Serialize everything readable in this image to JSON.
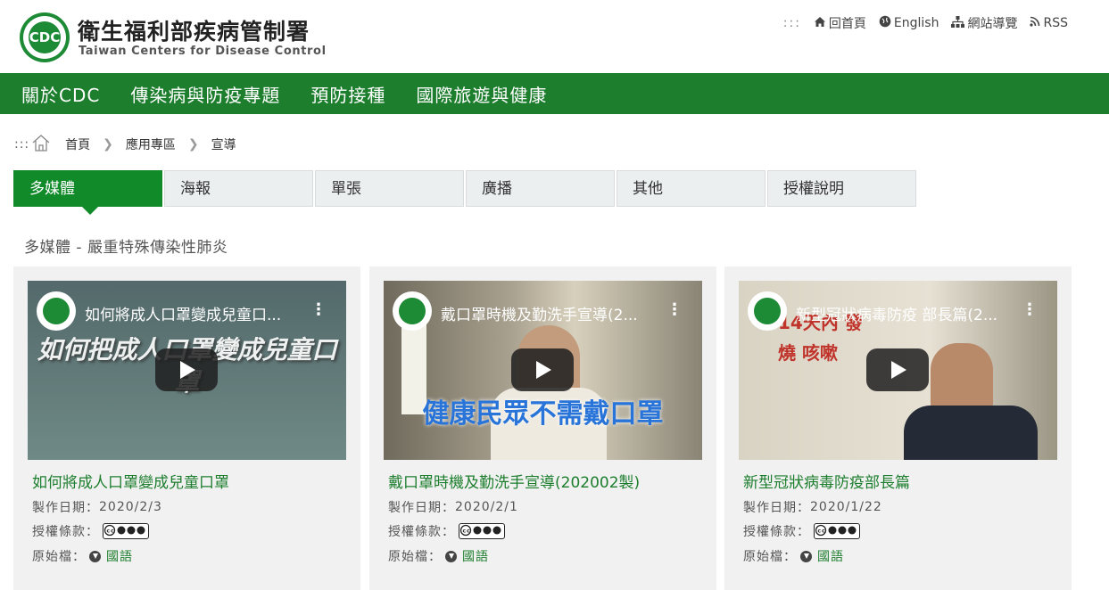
{
  "header": {
    "title": "衛生福利部疾病管制署",
    "subtitle": "Taiwan Centers for Disease Control",
    "logo_text": "CDC",
    "links": [
      {
        "label": "回首頁",
        "icon": "home-icon"
      },
      {
        "label": "English",
        "icon": "globe-icon"
      },
      {
        "label": "網站導覽",
        "icon": "sitemap-icon"
      },
      {
        "label": "RSS",
        "icon": "rss-icon"
      }
    ],
    "dots": ":::"
  },
  "nav": [
    "關於CDC",
    "傳染病與防疫專題",
    "預防接種",
    "國際旅遊與健康"
  ],
  "breadcrumb": {
    "dots": ":::",
    "items": [
      "首頁",
      "應用專區",
      "宣導"
    ]
  },
  "tabs": [
    "多媒體",
    "海報",
    "單張",
    "廣播",
    "其他",
    "授權說明"
  ],
  "section_title": "多媒體 - 嚴重特殊傳染性肺炎",
  "cards": [
    {
      "video_title": "如何將成人口罩變成兒童口...",
      "overlay": "如何把成人口罩變成兒童口罩",
      "title": "如何將成人口罩變成兒童口罩",
      "date_label": "製作日期：",
      "date": "2020/2/3",
      "license_label": "授權條款：",
      "source_label": "原始檔：",
      "source_link": "國語"
    },
    {
      "video_title": "戴口罩時機及勤洗手宣導(2...",
      "overlay": "健康民眾不需戴口罩",
      "title": "戴口罩時機及勤洗手宣導(202002製)",
      "date_label": "製作日期：",
      "date": "2020/2/1",
      "license_label": "授權條款：",
      "source_label": "原始檔：",
      "source_link": "國語"
    },
    {
      "video_title": "新型冠狀病毒防疫 部長篇(2...",
      "overlay": "14天內 發燒 咳嗽",
      "title": "新型冠狀病毒防疫部長篇",
      "date_label": "製作日期：",
      "date": "2020/1/22",
      "license_label": "授權條款：",
      "source_label": "原始檔：",
      "source_link": "國語"
    }
  ],
  "colors": {
    "nav": "#1d7e2e",
    "active_tab": "#118a2a",
    "link": "#1d7e2e"
  }
}
